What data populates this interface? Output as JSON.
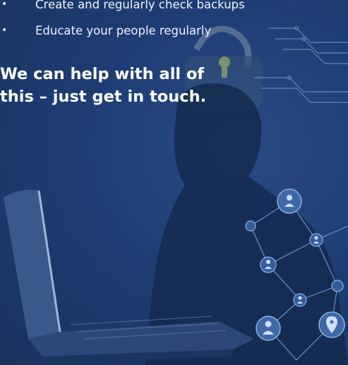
{
  "bullets": [
    {
      "text": "Create and regularly check backups"
    },
    {
      "text": "Educate your people regularly"
    }
  ],
  "bullet_marker": "•",
  "cta": {
    "line1": "We can help with all of",
    "line2": "this – just get in touch."
  },
  "colors": {
    "background": "#1f3d75",
    "text": "#ffffff",
    "network": "#6f93c6",
    "accent": "#c9d06b"
  }
}
